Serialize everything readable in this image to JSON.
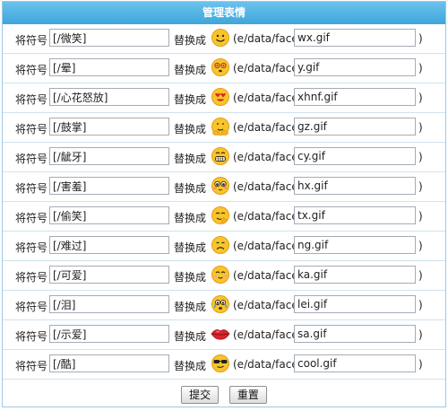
{
  "title": "管理表情",
  "label_prefix": "将符号",
  "replace_label": "替换成",
  "path_prefix": "(e/data/face/",
  "close_paren": ")",
  "rows": [
    {
      "code": "[/微笑]",
      "file": "wx.gif",
      "icon": "smile-icon"
    },
    {
      "code": "[/晕]",
      "file": "y.gif",
      "icon": "dizzy-icon"
    },
    {
      "code": "[/心花怒放]",
      "file": "xhnf.gif",
      "icon": "heart-eyes-icon"
    },
    {
      "code": "[/鼓掌]",
      "file": "gz.gif",
      "icon": "clapping-icon"
    },
    {
      "code": "[/龇牙]",
      "file": "cy.gif",
      "icon": "grin-icon"
    },
    {
      "code": "[/害羞]",
      "file": "hx.gif",
      "icon": "shy-icon"
    },
    {
      "code": "[/偷笑]",
      "file": "tx.gif",
      "icon": "snicker-icon"
    },
    {
      "code": "[/难过]",
      "file": "ng.gif",
      "icon": "sad-icon"
    },
    {
      "code": "[/可爱]",
      "file": "ka.gif",
      "icon": "cute-icon"
    },
    {
      "code": "[/泪]",
      "file": "lei.gif",
      "icon": "tears-icon"
    },
    {
      "code": "[/示爱]",
      "file": "sa.gif",
      "icon": "kiss-lips-icon"
    },
    {
      "code": "[/酷]",
      "file": "cool.gif",
      "icon": "cool-sunglasses-icon"
    }
  ],
  "buttons": {
    "submit": "提交",
    "reset": "重置"
  },
  "colors": {
    "header": "#4aaee2",
    "face_yellow": "#f7c52b",
    "lips": "#d9242c"
  }
}
